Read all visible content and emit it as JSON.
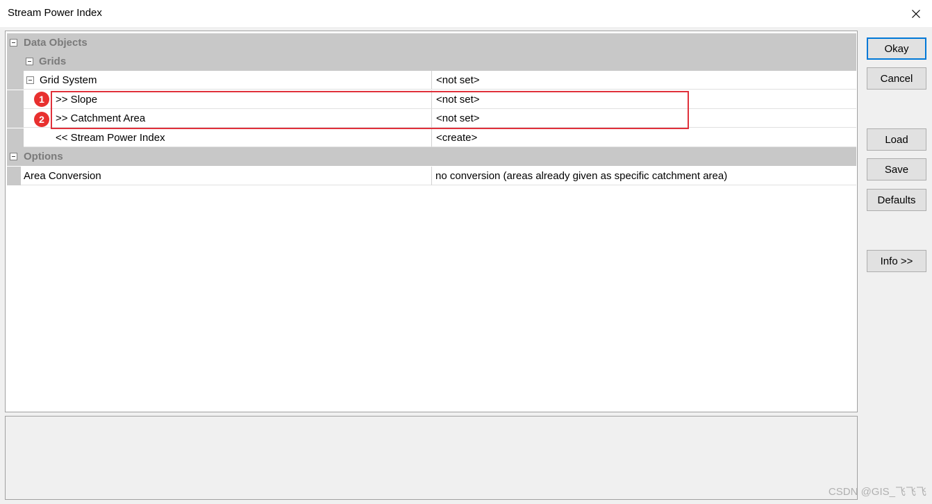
{
  "window": {
    "title": "Stream Power Index"
  },
  "tree": {
    "data_objects": {
      "label": "Data Objects"
    },
    "grids": {
      "label": "Grids"
    },
    "grid_system": {
      "label": "Grid System",
      "value": "<not set>"
    },
    "slope": {
      "label": ">> Slope",
      "value": "<not set>",
      "marker": "1"
    },
    "catchment_area": {
      "label": ">> Catchment Area",
      "value": "<not set>",
      "marker": "2"
    },
    "stream_power_index": {
      "label": "<< Stream Power Index",
      "value": "<create>"
    },
    "options": {
      "label": "Options"
    },
    "area_conversion": {
      "label": "Area Conversion",
      "value": "no conversion (areas already given as specific catchment area)"
    }
  },
  "buttons": {
    "okay": "Okay",
    "cancel": "Cancel",
    "load": "Load",
    "save": "Save",
    "defaults": "Defaults",
    "info": "Info >>"
  },
  "watermark": "CSDN @GIS_飞飞飞",
  "colors": {
    "highlight": "#e0303a",
    "marker": "#e8302f",
    "default_button_border": "#0078d7"
  },
  "icons": {
    "close": "close-icon",
    "collapse": "collapse-icon"
  }
}
